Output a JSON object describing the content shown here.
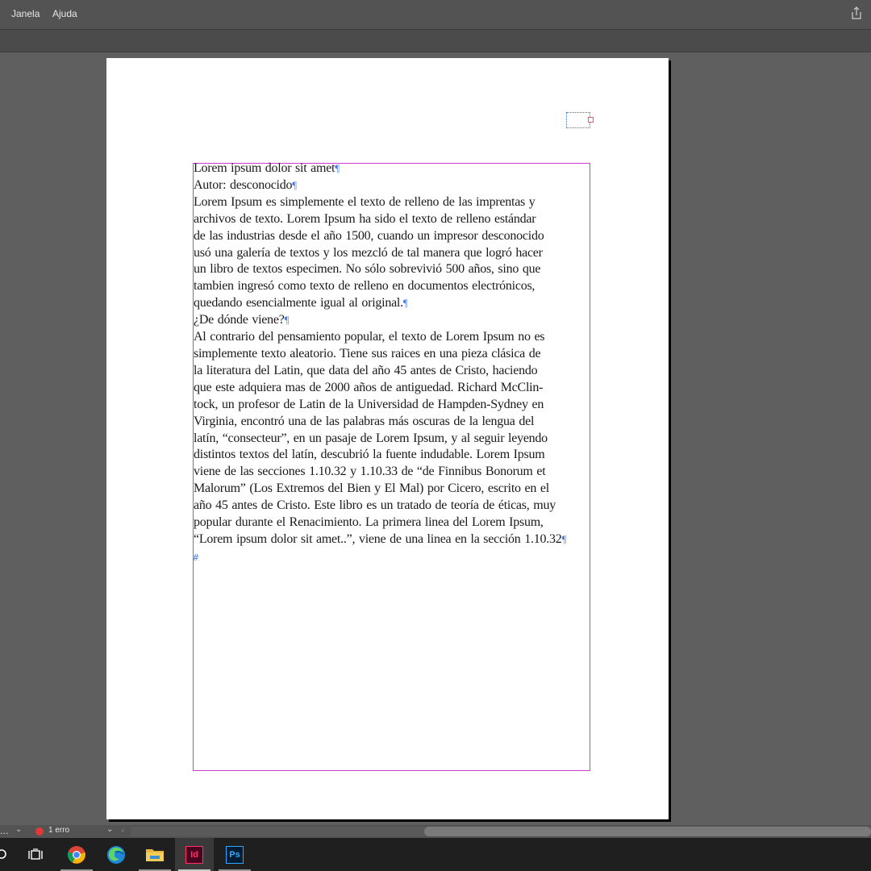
{
  "menu": {
    "items": [
      "Janela",
      "Ajuda"
    ]
  },
  "status": {
    "dots": "...",
    "errors": "1 erro"
  },
  "document": {
    "paragraphs": [
      [
        "Lorem ipsum dolor sit amet"
      ],
      [
        "Autor: desconocido"
      ],
      [
        "Lorem Ipsum es simplemente el texto de relleno de las imprentas y",
        "archivos de texto. Lorem Ipsum ha sido el texto de relleno estándar",
        "de las industrias desde el año 1500, cuando un impresor desconocido",
        "usó una galería de textos y los mezcló de tal manera que logró hacer",
        "un libro de textos especimen. No sólo sobrevivió 500 años, sino que",
        "tambien ingresó como texto de relleno en documentos electrónicos,",
        "quedando esencialmente igual al original."
      ],
      [
        "¿De dónde viene?"
      ],
      [
        "Al contrario del pensamiento popular, el texto de Lorem Ipsum no es",
        "simplemente texto aleatorio. Tiene sus raices en una pieza clásica de",
        "la literatura del Latin, que data del año 45 antes de Cristo, haciendo",
        "que este adquiera mas de 2000 años de antiguedad. Richard McClin-",
        "tock, un profesor de Latin de la Universidad de Hampden-Sydney en",
        "Virginia, encontró una de las palabras más oscuras de la lengua del",
        "latín, “consecteur”, en un pasaje de Lorem Ipsum, y al seguir leyendo",
        "distintos textos del latín, descubrió la fuente indudable. Lorem Ipsum",
        "viene de las secciones 1.10.32 y 1.10.33 de “de Finnibus Bonorum et",
        "Malorum” (Los Extremos del Bien y El Mal) por Cicero, escrito en el",
        "año 45 antes de Cristo. Este libro es un tratado de teoría de éticas, muy",
        "popular durante el Renacimiento. La primera linea del Lorem Ipsum,",
        "“Lorem ipsum dolor sit amet..”, viene de una linea en la sección 1.10.32"
      ]
    ],
    "pilcrow": "¶",
    "end_of_story": "#"
  },
  "taskbar": {
    "apps": [
      "search-icon",
      "task-view-icon",
      "chrome-icon",
      "edge-icon",
      "file-explorer-icon",
      "indesign-icon",
      "photoshop-icon"
    ],
    "indesign_label": "Id",
    "photoshop_label": "Ps"
  }
}
